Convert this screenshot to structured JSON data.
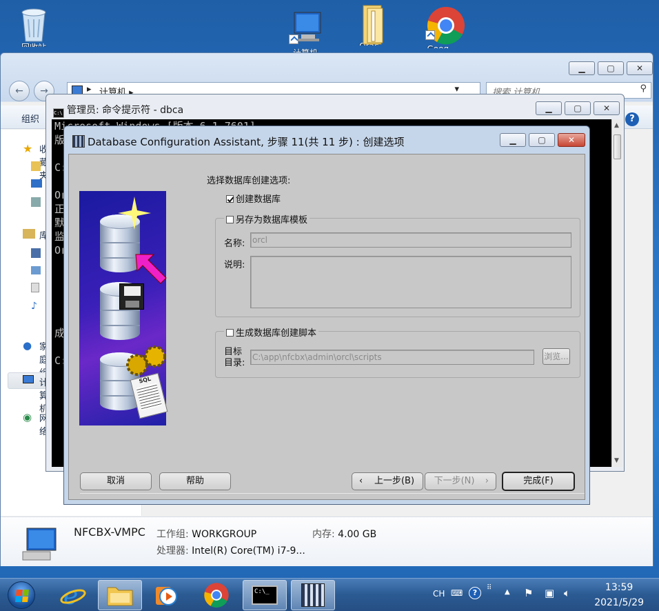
{
  "desktop": {
    "icons": [
      {
        "label": "回收站"
      },
      {
        "label": "计算机"
      },
      {
        "label": "Orac..."
      },
      {
        "label": "Goog..."
      }
    ]
  },
  "explorer": {
    "breadcrumb": [
      "计算机"
    ],
    "search_placeholder": "搜索 计算机",
    "toolbar_organize": "组织",
    "sidebar_items": [
      "收藏夹",
      "库",
      "家庭组",
      "计算机",
      "网络"
    ],
    "details": {
      "computer_name": "NFCBX-VMPC",
      "workgroup_label": "工作组:",
      "workgroup_value": "WORKGROUP",
      "memory_label": "内存:",
      "memory_value": "4.00 GB",
      "processor_label": "处理器:",
      "processor_value": "Intel(R) Core(TM) i7-9..."
    }
  },
  "cmd": {
    "title": "管理员: 命令提示符 - dbca",
    "lines": [
      "Microsoft Windows [版本 6.1.7601]",
      "版",
      "",
      "C:",
      "",
      "Or",
      "正",
      "默",
      "监",
      "Or",
      "",
      "",
      "",
      "",
      "",
      "成",
      "",
      "C:"
    ]
  },
  "dbca": {
    "title": "Database Configuration Assistant, 步骤 11(共 11 步) : 创建选项",
    "section_title": "选择数据库创建选项:",
    "create_db_label": "创建数据库",
    "create_db_checked": true,
    "save_template_label": "另存为数据库模板",
    "save_template_checked": false,
    "name_label": "名称:",
    "name_value": "orcl",
    "desc_label": "说明:",
    "desc_value": "",
    "gen_script_label": "生成数据库创建脚本",
    "gen_script_checked": false,
    "target_label_1": "目标",
    "target_label_2": "目录:",
    "target_value": "C:\\app\\nfcbx\\admin\\orcl\\scripts",
    "browse_label": "浏览...",
    "cancel_label": "取消",
    "help_label": "帮助",
    "back_label": "上一步(B)",
    "next_label": "下一步(N)",
    "finish_label": "完成(F)"
  },
  "taskbar": {
    "lang": "CH",
    "time": "13:59",
    "date": "2021/5/29"
  }
}
